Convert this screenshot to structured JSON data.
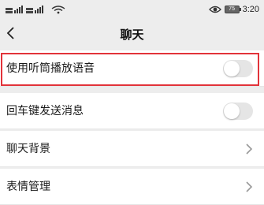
{
  "status_bar": {
    "net_left_1": "4G",
    "net_left_2": "4G",
    "net_icons": "4G ▂▄▆ 4G ▂▄▆",
    "battery": "75",
    "time": "3:20"
  },
  "nav": {
    "title": "聊天"
  },
  "settings": [
    {
      "label": "使用听筒播放语音",
      "control": "toggle",
      "on": false
    },
    {
      "label": "回车键发送消息",
      "control": "toggle",
      "on": false
    },
    {
      "label": "聊天背景",
      "control": "chevron"
    },
    {
      "label": "表情管理",
      "control": "chevron"
    }
  ],
  "colors": {
    "highlight": "#e2333a",
    "background": "#ededed",
    "toggle_off": "#e5e5e5"
  }
}
